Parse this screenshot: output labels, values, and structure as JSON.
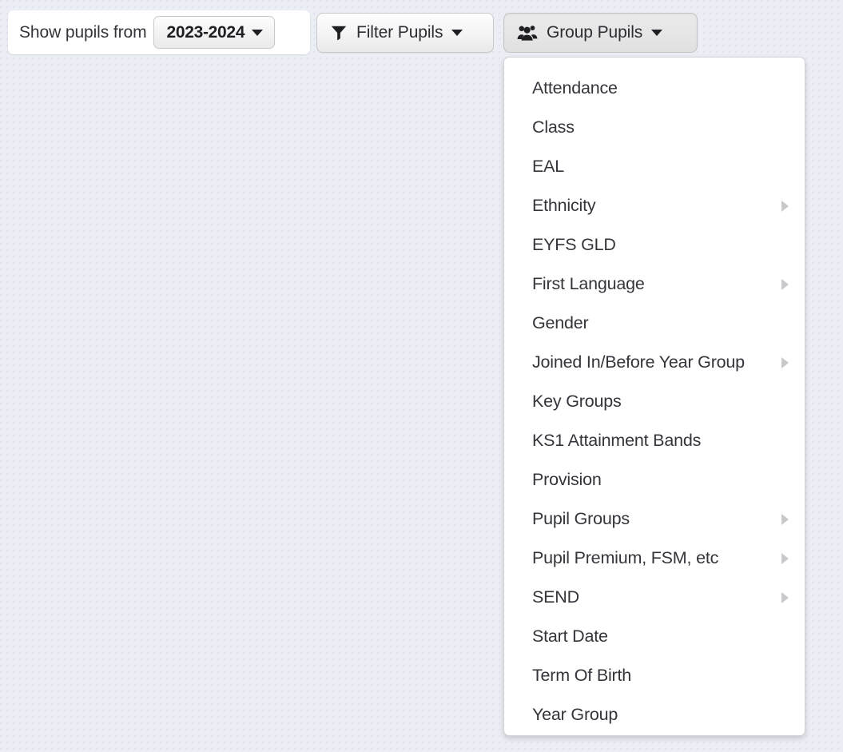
{
  "toolbar": {
    "year_filter": {
      "label": "Show pupils from",
      "selected_year": "2023-2024",
      "caret_icon": "caret-down-icon"
    },
    "filter_button": {
      "label": "Filter Pupils",
      "icon": "funnel-filter-icon",
      "caret_icon": "caret-down-icon",
      "active": false
    },
    "group_button": {
      "label": "Group Pupils",
      "icon": "users-group-icon",
      "caret_icon": "caret-down-icon",
      "active": true
    }
  },
  "group_menu": {
    "open": true,
    "submenu_arrow_icon": "caret-right-icon",
    "items": [
      {
        "label": "Attendance",
        "has_submenu": false
      },
      {
        "label": "Class",
        "has_submenu": false
      },
      {
        "label": "EAL",
        "has_submenu": false
      },
      {
        "label": "Ethnicity",
        "has_submenu": true
      },
      {
        "label": "EYFS GLD",
        "has_submenu": false
      },
      {
        "label": "First Language",
        "has_submenu": true
      },
      {
        "label": "Gender",
        "has_submenu": false
      },
      {
        "label": "Joined In/Before Year Group",
        "has_submenu": true
      },
      {
        "label": "Key Groups",
        "has_submenu": false
      },
      {
        "label": "KS1 Attainment Bands",
        "has_submenu": false
      },
      {
        "label": "Provision",
        "has_submenu": false
      },
      {
        "label": "Pupil Groups",
        "has_submenu": true
      },
      {
        "label": "Pupil Premium, FSM, etc",
        "has_submenu": true
      },
      {
        "label": "SEND",
        "has_submenu": true
      },
      {
        "label": "Start Date",
        "has_submenu": false
      },
      {
        "label": "Term Of Birth",
        "has_submenu": false
      },
      {
        "label": "Year Group",
        "has_submenu": false
      }
    ]
  },
  "colors": {
    "page_background": "#eceef5",
    "panel_background": "#ffffff",
    "text": "#33353b",
    "button_border": "#c9c9c9",
    "active_button_background": "#e5e5e5",
    "submenu_arrow": "#c9c9cc"
  }
}
